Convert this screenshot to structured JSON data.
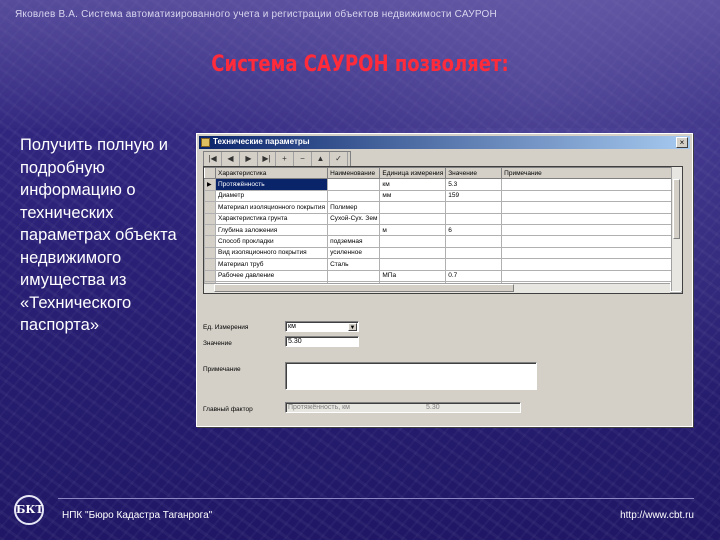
{
  "header": {
    "text": "Яковлев В.А. Система автоматизированного учета и регистрации объектов недвижимости САУРОН"
  },
  "title": "Система САУРОН позволяет:",
  "body_text": "Получить полную и подробную информацию о технических параметрах объекта недвижимого имущества из «Технического паспорта»",
  "window": {
    "title": "Технические параметры",
    "close_glyph": "×",
    "nav": [
      "|◀",
      "◀",
      "▶",
      "▶|",
      "+",
      "−",
      "▲",
      "✓",
      "✕"
    ],
    "grid": {
      "columns": [
        "Характеристика",
        "Наименование",
        "Единица измерения",
        "Значение",
        "Примечание"
      ],
      "rows": [
        [
          "Протяжённость",
          "",
          "км",
          "5.3",
          ""
        ],
        [
          "Диаметр",
          "",
          "мм",
          "159",
          ""
        ],
        [
          "Материал изоляционного покрытия",
          "Полимер",
          "",
          "",
          ""
        ],
        [
          "Характеристика грунта",
          "Сухой-Сух. Зем",
          "",
          "",
          ""
        ],
        [
          "Глубина заложения",
          "",
          "м",
          "6",
          ""
        ],
        [
          "Способ прокладки",
          "подземная",
          "",
          "",
          ""
        ],
        [
          "Вид изоляционного покрытия",
          "усиленное",
          "",
          "",
          ""
        ],
        [
          "Материал труб",
          "Сталь",
          "",
          "",
          ""
        ],
        [
          "Рабочее давление",
          "",
          "МПа",
          "0.7",
          ""
        ],
        [
          "",
          "",
          "",
          "",
          ""
        ],
        [
          "",
          "",
          "",
          "",
          ""
        ]
      ]
    },
    "form": {
      "unit_label": "Ед. Измерения",
      "unit_value": "км",
      "quantity_label": "Значение",
      "quantity_value": "5.30",
      "note_label": "Примечание",
      "note_value": "",
      "extra_label": "Главный фактор",
      "extra_value": "Протяжённость, км",
      "extra_value2": "5.30"
    }
  },
  "footer": {
    "left": "НПК \"Бюро Кадастра Таганрога\"",
    "right": "http://www.cbt.ru",
    "logo_text": "БКТ"
  }
}
